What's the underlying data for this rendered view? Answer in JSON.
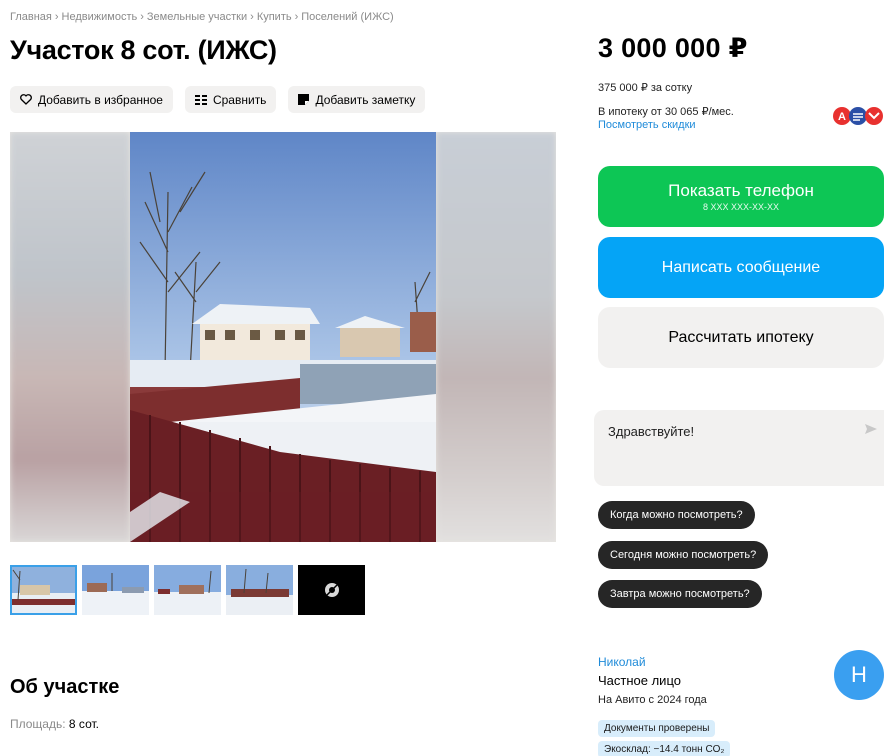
{
  "breadcrumb": {
    "items": [
      "Главная",
      "Недвижимость",
      "Земельные участки",
      "Купить",
      "Поселений (ИЖС)"
    ],
    "separator": "›"
  },
  "listing": {
    "title": "Участок 8 сот. (ИЖС)"
  },
  "actions": {
    "favorite_label": "Добавить в избранное",
    "compare_label": "Сравнить",
    "note_label": "Добавить заметку"
  },
  "gallery": {
    "thumbnails": [
      "thumb-1",
      "thumb-2",
      "thumb-3",
      "thumb-4",
      "thumb-more"
    ]
  },
  "about": {
    "heading": "Об участке",
    "area_label": "Площадь:",
    "area_value": "8 сот."
  },
  "price": {
    "value": "3 000 000 ₽",
    "per_unit": "375 000 ₽ за сотку",
    "mortgage_text": "В ипотеку от 30 065 ₽/мес.",
    "discount_link": "Посмотреть скидки"
  },
  "buttons": {
    "phone_label": "Показать телефон",
    "phone_masked": "8 XXX XXX-XX-XX",
    "message_label": "Написать сообщение",
    "mortgage_label": "Рассчитать ипотеку"
  },
  "chat": {
    "message": "Здравствуйте!",
    "suggestions": [
      "Когда можно посмотреть?",
      "Сегодня можно посмотреть?",
      "Завтра можно посмотреть?"
    ]
  },
  "seller": {
    "name": "Николай",
    "type": "Частное лицо",
    "since": "На Авито с 2024 года",
    "avatar_letter": "Н",
    "badges": [
      "Документы проверены",
      "Экосклад: −14.4 тонн CO₂"
    ]
  },
  "colors": {
    "phone_button": "#0dc655",
    "message_button": "#05a4f6",
    "link": "#1f8bd9",
    "avatar": "#3a9ff0"
  }
}
